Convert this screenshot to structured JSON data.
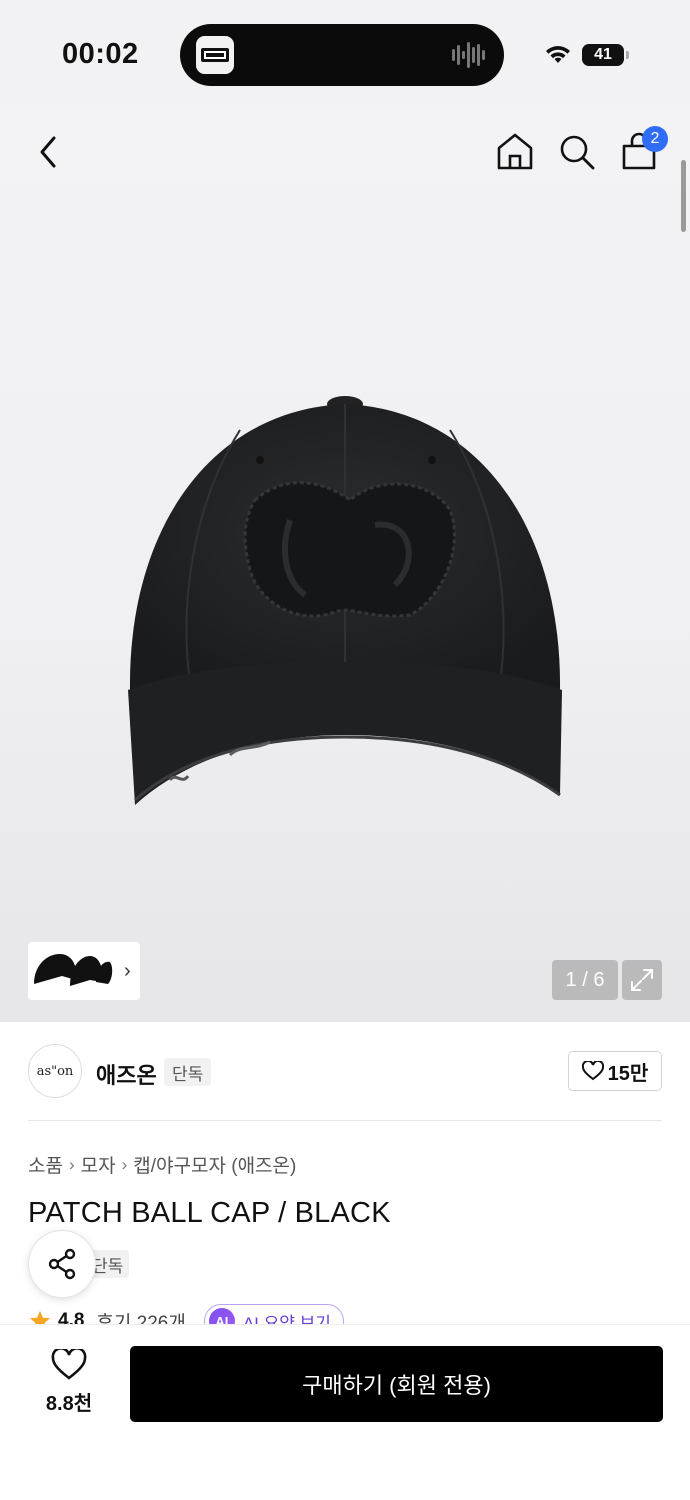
{
  "status_bar": {
    "time": "00:02",
    "battery": "41"
  },
  "nav": {
    "cart_count": "2"
  },
  "gallery": {
    "page_indicator": "1 / 6"
  },
  "brand": {
    "logo_text": "as\"on",
    "name": "애즈온",
    "exclusive_tag": "단독",
    "likes": "15만"
  },
  "breadcrumb": [
    "소품",
    "모자",
    "캡/야구모자 (애즈온)"
  ],
  "product": {
    "title": "PATCH BALL CAP / BLACK",
    "exclusive_tag": "단독",
    "rating": "4.8",
    "reviews": "후기 226개",
    "ai_badge": "AI",
    "ai_summary_label": "AI 요약 보기"
  },
  "bottom_bar": {
    "wish_count": "8.8천",
    "buy_label": "구매하기 (회원 전용)"
  },
  "colors": {
    "accent_blue": "#2f6df6",
    "star": "#f5a623",
    "ai_purple": "#7a4ef0",
    "buy_button": "#000000"
  },
  "icons": [
    "back-icon",
    "home-icon",
    "search-icon",
    "bag-icon",
    "expand-icon",
    "heart-icon",
    "share-icon",
    "star-icon",
    "wifi-icon",
    "battery-icon"
  ]
}
